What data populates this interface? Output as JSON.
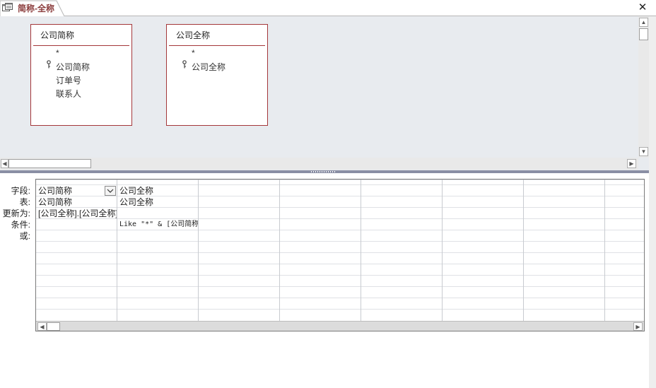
{
  "tab": {
    "title": "简称-全称",
    "icon": "query-icon",
    "close": "✕"
  },
  "tables": [
    {
      "title": "公司简称",
      "fields": [
        {
          "name": "*",
          "key": false
        },
        {
          "name": "公司简称",
          "key": true
        },
        {
          "name": "订单号",
          "key": false
        },
        {
          "name": "联系人",
          "key": false
        }
      ]
    },
    {
      "title": "公司全称",
      "fields": [
        {
          "name": "*",
          "key": false
        },
        {
          "name": "公司全称",
          "key": true
        }
      ]
    }
  ],
  "grid": {
    "row_labels": [
      "字段:",
      "表:",
      "更新为:",
      "条件:",
      "或:"
    ],
    "columns": [
      {
        "field": "公司简称",
        "table": "公司简称",
        "update_to": "[公司全称].[公司全称]",
        "criteria": "",
        "or": ""
      },
      {
        "field": "公司全称",
        "table": "公司全称",
        "update_to": "",
        "criteria": "Like \"*\" & [公司简称]",
        "or": ""
      }
    ]
  },
  "colors": {
    "accent": "#a4373a",
    "tab_text": "#8b3c3c",
    "designer_bg": "#e8ebef"
  }
}
